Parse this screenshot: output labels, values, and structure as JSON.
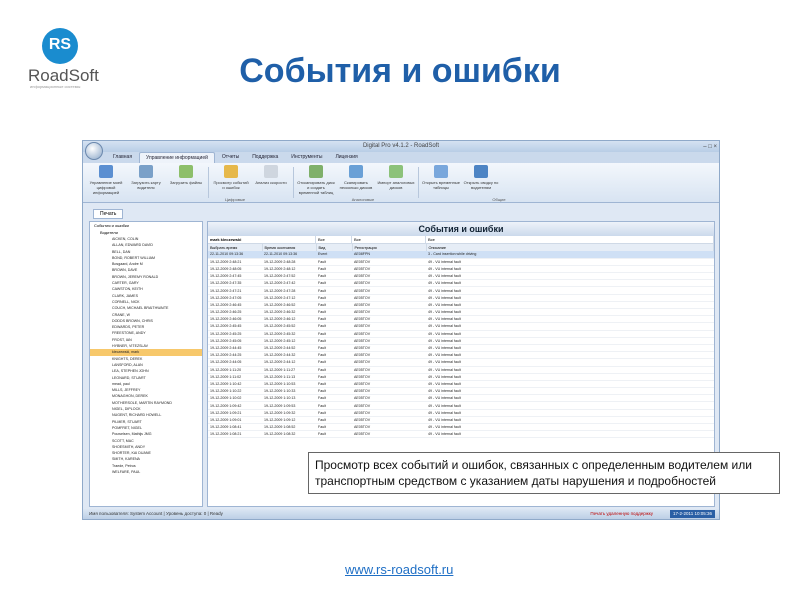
{
  "logo": {
    "mark": "RS",
    "name": "RoadSoft",
    "tagline": "информационные системы"
  },
  "slide_title": "События и ошибки",
  "window": {
    "title": "Digital Pro v4.1.2 - RoadSoft",
    "controls": "– □ ×",
    "tabs": [
      "Главная",
      "Управление информацией",
      "Отчеты",
      "Поддержка",
      "Инструменты",
      "Лицензия"
    ],
    "ribbon_buttons": [
      {
        "label": "Управление моей цифровой информацией",
        "color": "#5b8fd1"
      },
      {
        "label": "Загрузить карту водителя",
        "color": "#7aa0c8"
      },
      {
        "label": "Загрузить файлы",
        "color": "#8dbf6a"
      },
      {
        "label": "Просмотр событий и ошибок",
        "color": "#e6b84a"
      },
      {
        "label": "Анализ скорости",
        "color": "#cfd6df"
      },
      {
        "label": "Отсканировать диск и создать временной таблиц",
        "color": "#7fb06a"
      },
      {
        "label": "Сканировать несколько дисков",
        "color": "#6aa0d6"
      },
      {
        "label": "Импорт аналоговых дисков",
        "color": "#8cc27a"
      },
      {
        "label": "Открыть временные таблицы",
        "color": "#79a7dc"
      },
      {
        "label": "Открыть сводку по водителям",
        "color": "#4d84c4"
      }
    ],
    "ribbon_groups": [
      "Цифровые",
      "Аналоговые",
      "Общие"
    ],
    "doc_tab": "Печать",
    "tree": {
      "root": "События и ошибки",
      "group": "Водители",
      "drivers": [
        "AICKEN, COLIN",
        "ALLAN, EDWARD DAVID",
        "BELL, DAN",
        "BOND, ROBERT WILLIAM",
        "Bosgaard, Andre M",
        "BROWN, DAVE",
        "BROWN, JEREMY RONALD",
        "CARTER, GARY",
        "CAWSTON, KEITH",
        "CLARK, JAMES",
        "CORNELL, NICK",
        "COUCH, MICHAEL BRAITHWAITE",
        "CRANE, W",
        "DODDS BROWN, CHRIS",
        "EDWARDS, PETER",
        "FREESTONE, ANDY",
        "FROST, IAN",
        "HYBNER, VITEZSLAV",
        "kleczewski, mark",
        "KNIGHTS, DEREK",
        "LANSFORD, ALAN",
        "LEA, STEPHEN JOHN",
        "LEONARD, STUART",
        "mead, paul",
        "MILLS, JEFFREY",
        "MONAGHON, DEREK",
        "MOTHERSOLE, MARTIN RAYMOND",
        "NIGEL, DIPLOCK",
        "NUGENT, RICHARD HOWELL",
        "PILMER, STUART",
        "POMFRET, NIGEL",
        "Pouwelsen, Mathijs JMG",
        "SCOTT, MAC",
        "SHOESMITH, ANDY",
        "SHORTER, KAI DUANE",
        "SMITH, KARENA",
        "Traede, Petrus",
        "WELFARE, PAUL"
      ],
      "selected_index": 18
    },
    "panel": {
      "title": "События и ошибки",
      "filter_driver": "mark kleczewski",
      "filter_all_1": "Все",
      "filter_all_2": "Все",
      "filter_all_3": "Все",
      "columns": [
        "Выбрать время",
        "Время окончания",
        "Вид",
        "Регистрация",
        "Описание"
      ],
      "rows": [
        [
          "22-11-2010 09:13:36",
          "22-11-2010 09:13:36",
          "Event",
          "AE08FPN",
          "3 - Card insertion while driving"
        ],
        [
          "19-12-2009 2:48:21",
          "19-12-2009 2:48:28",
          "Fault",
          "AE05TOV",
          "49 - VU internal fault"
        ],
        [
          "19-12-2009 2:48:05",
          "19-12-2009 2:48:12",
          "Fault",
          "AE05TOV",
          "49 - VU internal fault"
        ],
        [
          "19-12-2009 2:47:45",
          "19-12-2009 2:47:52",
          "Fault",
          "AE05TOV",
          "49 - VU internal fault"
        ],
        [
          "19-12-2009 2:47:35",
          "19-12-2009 2:47:42",
          "Fault",
          "AE05TOV",
          "49 - VU internal fault"
        ],
        [
          "19-12-2009 2:47:21",
          "19-12-2009 2:47:28",
          "Fault",
          "AE05TOV",
          "49 - VU internal fault"
        ],
        [
          "19-12-2009 2:47:05",
          "19-12-2009 2:47:12",
          "Fault",
          "AE05TOV",
          "49 - VU internal fault"
        ],
        [
          "19-12-2009 2:46:45",
          "19-12-2009 2:46:52",
          "Fault",
          "AE05TOV",
          "49 - VU internal fault"
        ],
        [
          "19-12-2009 2:46:25",
          "19-12-2009 2:46:32",
          "Fault",
          "AE05TOV",
          "49 - VU internal fault"
        ],
        [
          "19-12-2009 2:46:05",
          "19-12-2009 2:46:12",
          "Fault",
          "AE05TOV",
          "49 - VU internal fault"
        ],
        [
          "19-12-2009 2:45:45",
          "19-12-2009 2:45:52",
          "Fault",
          "AE05TOV",
          "49 - VU internal fault"
        ],
        [
          "19-12-2009 2:45:25",
          "19-12-2009 2:45:32",
          "Fault",
          "AE05TOV",
          "49 - VU internal fault"
        ],
        [
          "19-12-2009 2:45:05",
          "19-12-2009 2:45:12",
          "Fault",
          "AE05TOV",
          "49 - VU internal fault"
        ],
        [
          "19-12-2009 2:44:45",
          "19-12-2009 2:44:52",
          "Fault",
          "AE05TOV",
          "49 - VU internal fault"
        ],
        [
          "19-12-2009 2:44:25",
          "19-12-2009 2:44:32",
          "Fault",
          "AE05TOV",
          "49 - VU internal fault"
        ],
        [
          "19-12-2009 2:44:05",
          "19-12-2009 2:44:12",
          "Fault",
          "AE05TOV",
          "49 - VU internal fault"
        ],
        [
          "19-12-2009 1:11:20",
          "19-12-2009 1:11:27",
          "Fault",
          "AE05TOV",
          "49 - VU internal fault"
        ],
        [
          "19-12-2009 1:11:02",
          "19-12-2009 1:11:13",
          "Fault",
          "AE05TOV",
          "49 - VU internal fault"
        ],
        [
          "19-12-2009 1:10:42",
          "19-12-2009 1:10:53",
          "Fault",
          "AE05TOV",
          "49 - VU internal fault"
        ],
        [
          "19-12-2009 1:10:22",
          "19-12-2009 1:10:33",
          "Fault",
          "AE05TOV",
          "49 - VU internal fault"
        ],
        [
          "19-12-2009 1:10:02",
          "19-12-2009 1:10:13",
          "Fault",
          "AE05TOV",
          "49 - VU internal fault"
        ],
        [
          "19-12-2009 1:09:42",
          "19-12-2009 1:09:53",
          "Fault",
          "AE05TOV",
          "49 - VU internal fault"
        ],
        [
          "19-12-2009 1:09:21",
          "19-12-2009 1:09:32",
          "Fault",
          "AE05TOV",
          "49 - VU internal fault"
        ],
        [
          "19-12-2009 1:09:01",
          "19-12-2009 1:09:12",
          "Fault",
          "AE05TOV",
          "49 - VU internal fault"
        ],
        [
          "19-12-2009 1:08:41",
          "19-12-2009 1:08:52",
          "Fault",
          "AE05TOV",
          "49 - VU internal fault"
        ],
        [
          "19-12-2009 1:08:21",
          "19-12-2009 1:08:32",
          "Fault",
          "AE05TOV",
          "49 - VU internal fault"
        ]
      ]
    },
    "status": {
      "left": "Имя пользователя: System Account  |  Уровень доступа: 0  |  Ready",
      "print": "Печать удаленную поддержку",
      "clock": "17-2-2011 10:05:36"
    }
  },
  "callout": "Просмотр всех событий и ошибок, связанных с определенным водителем или транспортным средством с указанием даты нарушения и подробностей",
  "footer_link": "www.rs-roadsoft.ru",
  "colors": {
    "title": "#1f5fa8",
    "brand": "#1a8ccf",
    "link": "#1f6fc5"
  }
}
